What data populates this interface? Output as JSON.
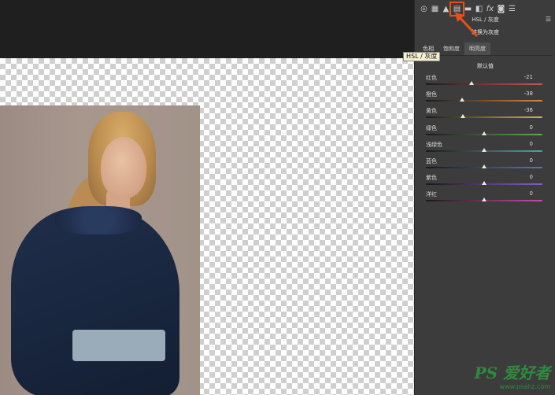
{
  "panel": {
    "title": "HSL / 灰度",
    "menu_icon": "menu-icon",
    "convert_label": "转换为灰度",
    "tabs": [
      {
        "label": "色相",
        "active": false
      },
      {
        "label": "饱和度",
        "active": false
      },
      {
        "label": "明亮度",
        "active": true
      }
    ],
    "default_label": "默认值",
    "sliders": [
      {
        "label": "红色",
        "value": "-21",
        "level": -21,
        "track": [
          "#1a1a1a",
          "#c85a4a"
        ]
      },
      {
        "label": "橙色",
        "value": "-38",
        "level": -38,
        "track": [
          "#1a1a1a",
          "#d4884a"
        ]
      },
      {
        "label": "黄色",
        "value": "-36",
        "level": -36,
        "track": [
          "#1a1a1a",
          "#cbb84a"
        ]
      },
      {
        "label": "绿色",
        "value": "0",
        "level": 0,
        "track": [
          "#1a1a1a",
          "#62a84f"
        ]
      },
      {
        "label": "浅绿色",
        "value": "0",
        "level": 0,
        "track": [
          "#1a1a1a",
          "#4fa5a0"
        ]
      },
      {
        "label": "蓝色",
        "value": "0",
        "level": 0,
        "track": [
          "#1a1a1a",
          "#4a78c8"
        ]
      },
      {
        "label": "紫色",
        "value": "0",
        "level": 0,
        "track": [
          "#1a1a1a",
          "#8a5ac8"
        ]
      },
      {
        "label": "洋红",
        "value": "0",
        "level": 0,
        "track": [
          "#1a1a1a",
          "#c84aa8"
        ]
      }
    ]
  },
  "toolbar_icons": [
    "basic-icon",
    "tone-curve-icon",
    "detail-icon",
    "hsl-icon",
    "split-toning-icon",
    "lens-icon",
    "fx-icon",
    "camera-calibration-icon",
    "presets-icon"
  ],
  "tooltip": "HSL / 灰度",
  "accent": "#e8501b",
  "watermark": {
    "logo": "PS 爱好者",
    "url": "www.psahz.com"
  }
}
